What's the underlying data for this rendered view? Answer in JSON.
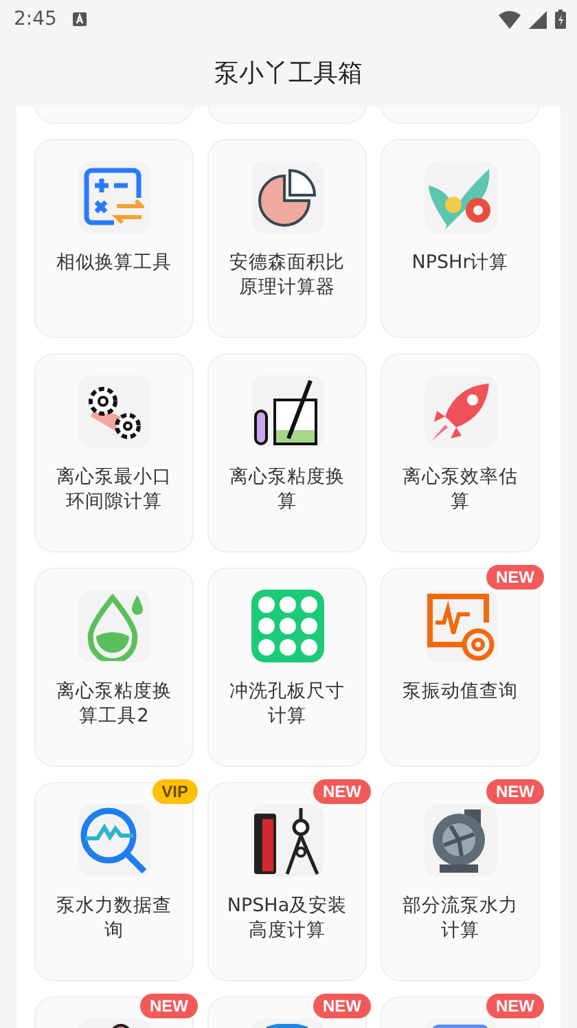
{
  "status_bar": {
    "time": "2:45"
  },
  "app_bar": {
    "title": "泵小丫工具箱"
  },
  "tools": [
    {
      "label": "相似换算工具"
    },
    {
      "label": "安德森面积比原理计算器"
    },
    {
      "label": "NPSHr计算"
    },
    {
      "label": "离心泵最小口环间隙计算"
    },
    {
      "label": "离心泵粘度换算"
    },
    {
      "label": "离心泵效率估算"
    },
    {
      "label": "离心泵粘度换算工具2"
    },
    {
      "label": "冲洗孔板尺寸计算"
    },
    {
      "label": "泵振动值查询",
      "badge": {
        "kind": "new",
        "text": "NEW"
      }
    },
    {
      "label": "泵水力数据查询",
      "badge": {
        "kind": "vip",
        "text": "VIP"
      }
    },
    {
      "label": "NPSHa及安装高度计算",
      "badge": {
        "kind": "new",
        "text": "NEW"
      }
    },
    {
      "label": "部分流泵水力计算",
      "badge": {
        "kind": "new",
        "text": "NEW"
      }
    },
    {
      "badge": {
        "kind": "new",
        "text": "NEW"
      }
    },
    {
      "badge": {
        "kind": "new",
        "text": "NEW"
      }
    },
    {
      "badge": {
        "kind": "new",
        "text": "NEW"
      }
    }
  ]
}
